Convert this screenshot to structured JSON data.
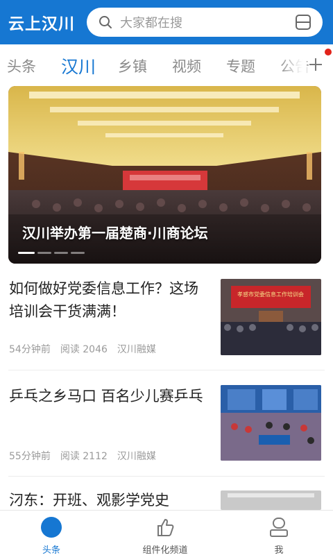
{
  "header": {
    "brand": "云上汉川",
    "search_placeholder": "大家都在搜"
  },
  "tabs": [
    {
      "label": "头条",
      "active": false
    },
    {
      "label": "汉川",
      "active": true
    },
    {
      "label": "乡镇",
      "active": false
    },
    {
      "label": "视频",
      "active": false
    },
    {
      "label": "专题",
      "active": false
    },
    {
      "label": "公告",
      "active": false
    }
  ],
  "banner": {
    "caption": "汉川举办第一届楚商·川商论坛",
    "slide_count": 4,
    "active_slide": 1
  },
  "news": [
    {
      "title": "如何做好党委信息工作？这场培训会干货满满！",
      "time": "54分钟前",
      "reads": "阅读 2046",
      "source": "汉川融媒",
      "thumb_text": "孝感市党委信息工作培训会"
    },
    {
      "title": "乒乓之乡马口 百名少儿赛乒乓",
      "time": "55分钟前",
      "reads": "阅读 2112",
      "source": "汉川融媒"
    },
    {
      "title": "汈东：开班、观影学党史"
    }
  ],
  "bottom_nav": [
    {
      "label": "头条",
      "icon": "home-circle-icon",
      "active": true
    },
    {
      "label": "组件化频道",
      "icon": "thumbs-up-icon",
      "active": false
    },
    {
      "label": "我",
      "icon": "user-icon",
      "active": false
    }
  ],
  "colors": {
    "brand_blue": "#1677d2",
    "notification_red": "#e2231a"
  }
}
